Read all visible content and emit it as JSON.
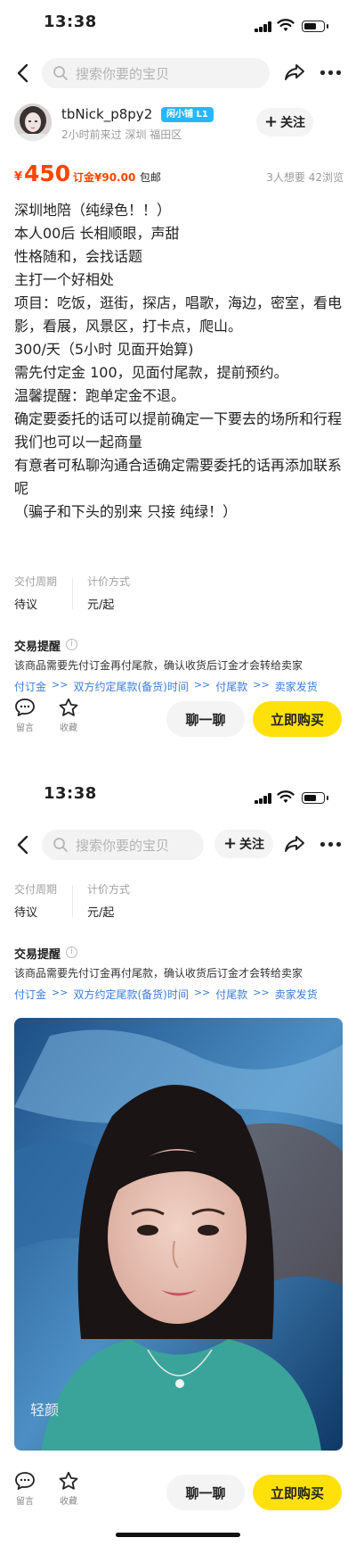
{
  "status_bar": {
    "time": "13:38"
  },
  "search": {
    "placeholder": "搜索你要的宝贝"
  },
  "seller": {
    "name": "tbNick_p8py2",
    "badge": "闲小铺 L1",
    "meta": "2小时前来过  深圳 福田区",
    "follow_label": "关注"
  },
  "price": {
    "currency": "¥",
    "value": "450",
    "deposit": "订金¥90.00",
    "shipping": "包邮",
    "stats": "3人想要  42浏览"
  },
  "description": [
    "深圳地陪（纯绿色！！）",
    "本人00后  长相顺眼，声甜",
    "性格随和，会找话题",
    "主打一个好相处",
    "项目：吃饭，逛街，探店，唱歌，海边，密室，看电影，看展，风景区，打卡点，爬山。",
    "300/天（5小时 见面开始算)",
    "需先付定金 100，见面付尾款，提前预约。",
    "温馨提醒：跑单定金不退。",
    "确定要委托的话可以提前确定一下要去的场所和行程 我们也可以一起商量",
    "有意者可私聊沟通合适确定需要委托的话再添加联系呢",
    "（骗子和下头的别来 只接 纯绿！）"
  ],
  "info": {
    "delivery_label": "交付周期",
    "delivery_value": "待议",
    "pricing_label": "计价方式",
    "pricing_value": "元/起"
  },
  "tips": {
    "title": "交易提醒",
    "text": "该商品需要先付订金再付尾款，确认收货后订金才会转给卖家",
    "steps": [
      "付订金",
      "双方约定尾款(备货)时间",
      "付尾款",
      "卖家发货"
    ],
    "arrow": ">>"
  },
  "bottom_bar": {
    "comment_label": "留言",
    "favorite_label": "收藏",
    "chat_label": "聊一聊",
    "buy_label": "立即购买"
  },
  "photo_watermark": "轻颜",
  "colors": {
    "price_orange": "#ff4400",
    "buy_yellow": "#ffe10a",
    "link_blue": "#3b7cd9",
    "badge_blue": "#24b8ff"
  }
}
